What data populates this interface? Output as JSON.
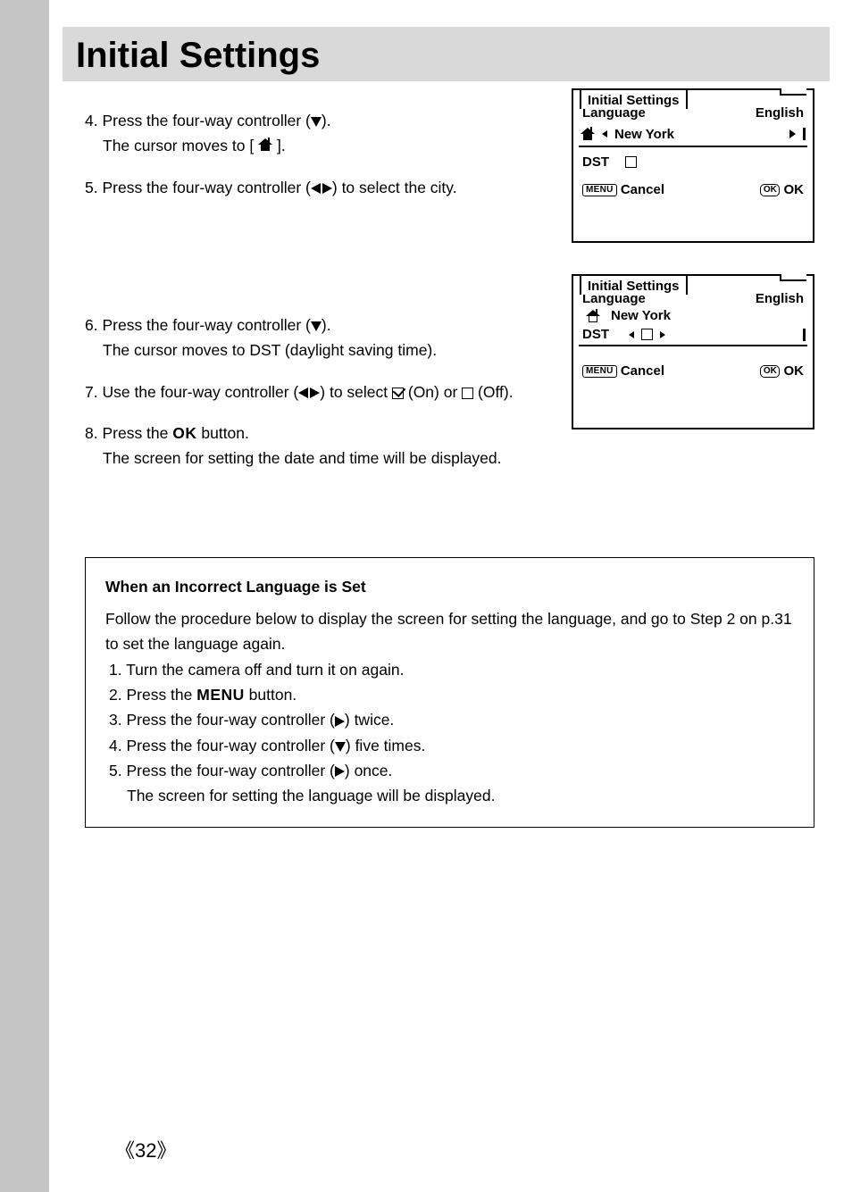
{
  "title": "Initial Settings",
  "steps": {
    "s4a": "4. Press the four-way controller (",
    "s4b": ").",
    "s4c": "The cursor moves to [ ",
    "s4d": " ].",
    "s5a": "5. Press the four-way controller (",
    "s5b": ") to select the city.",
    "s6a": "6. Press the four-way controller (",
    "s6b": ").",
    "s6c": "The cursor moves to DST (daylight saving time).",
    "s7a": "7. Use the four-way controller (",
    "s7b": ") to select ",
    "s7c": " (On) or ",
    "s7d": " (Off).",
    "s8a": "8. Press the ",
    "s8b": " button.",
    "s8c": "The screen for setting the date and time will be displayed.",
    "ok": "OK"
  },
  "screen": {
    "tab": "Initial Settings",
    "lang_label": "Language",
    "lang_value": "English",
    "city": "New York",
    "dst": "DST",
    "menu": "MENU",
    "cancel": "Cancel",
    "okbox": "OK",
    "ok": "OK"
  },
  "note": {
    "title": "When an Incorrect Language is Set",
    "intro": "Follow the procedure below to display the screen for setting the language, and go to Step 2 on p.31 to set the language again.",
    "n1": "1. Turn the camera off and turn it on again.",
    "n2a": "2. Press the ",
    "n2b": "MENU",
    "n2c": " button.",
    "n3a": "3. Press the four-way controller (",
    "n3b": ") twice.",
    "n4a": "4. Press the four-way controller (",
    "n4b": ") five times.",
    "n5a": "5. Press the four-way controller (",
    "n5b": ") once.",
    "n5c": "The screen for setting the language will be displayed."
  },
  "page_number": "32"
}
